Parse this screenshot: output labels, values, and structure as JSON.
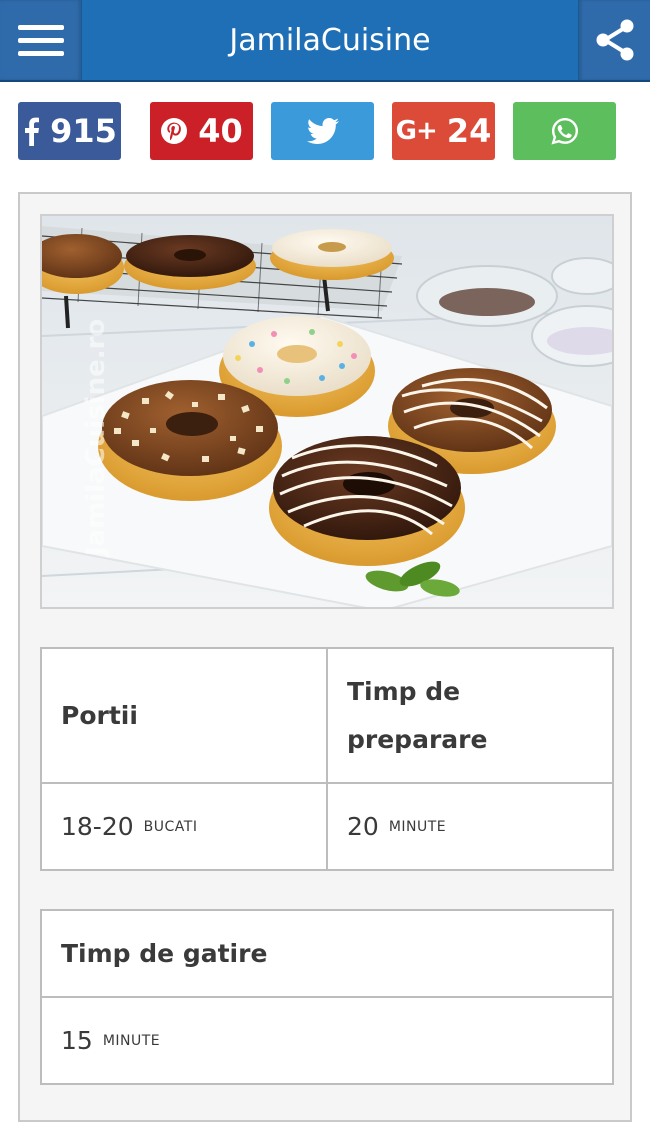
{
  "app": {
    "title": "JamilaCuisine"
  },
  "icons": {
    "menu": "hamburger-menu-icon",
    "share": "share-icon",
    "facebook": "facebook-icon",
    "pinterest": "pinterest-icon",
    "twitter": "twitter-icon",
    "googleplus": "google-plus-icon",
    "whatsapp": "whatsapp-icon"
  },
  "social": {
    "facebook": {
      "count": "915",
      "color": "#3b5a9a"
    },
    "pinterest": {
      "count": "40",
      "color": "#cb2027"
    },
    "twitter": {
      "color": "#3b9ad9"
    },
    "googleplus": {
      "label": "G+",
      "count": "24",
      "color": "#dc4a38"
    },
    "whatsapp": {
      "color": "#5cbe5c"
    }
  },
  "photo": {
    "watermark": "JamilaCuisine.ro"
  },
  "recipe_info": {
    "portions": {
      "label": "Portii",
      "value": "18-20",
      "unit": "BUCATI"
    },
    "prep_time": {
      "label_line1": "Timp de",
      "label_line2": "preparare",
      "value": "20",
      "unit": "MINUTE"
    },
    "cook_time": {
      "label": "Timp de gatire",
      "value": "15",
      "unit": "MINUTE"
    }
  },
  "colors": {
    "appbar": "#1f6fb7",
    "card_bg": "#f5f5f5",
    "border": "#bdbdbd"
  }
}
